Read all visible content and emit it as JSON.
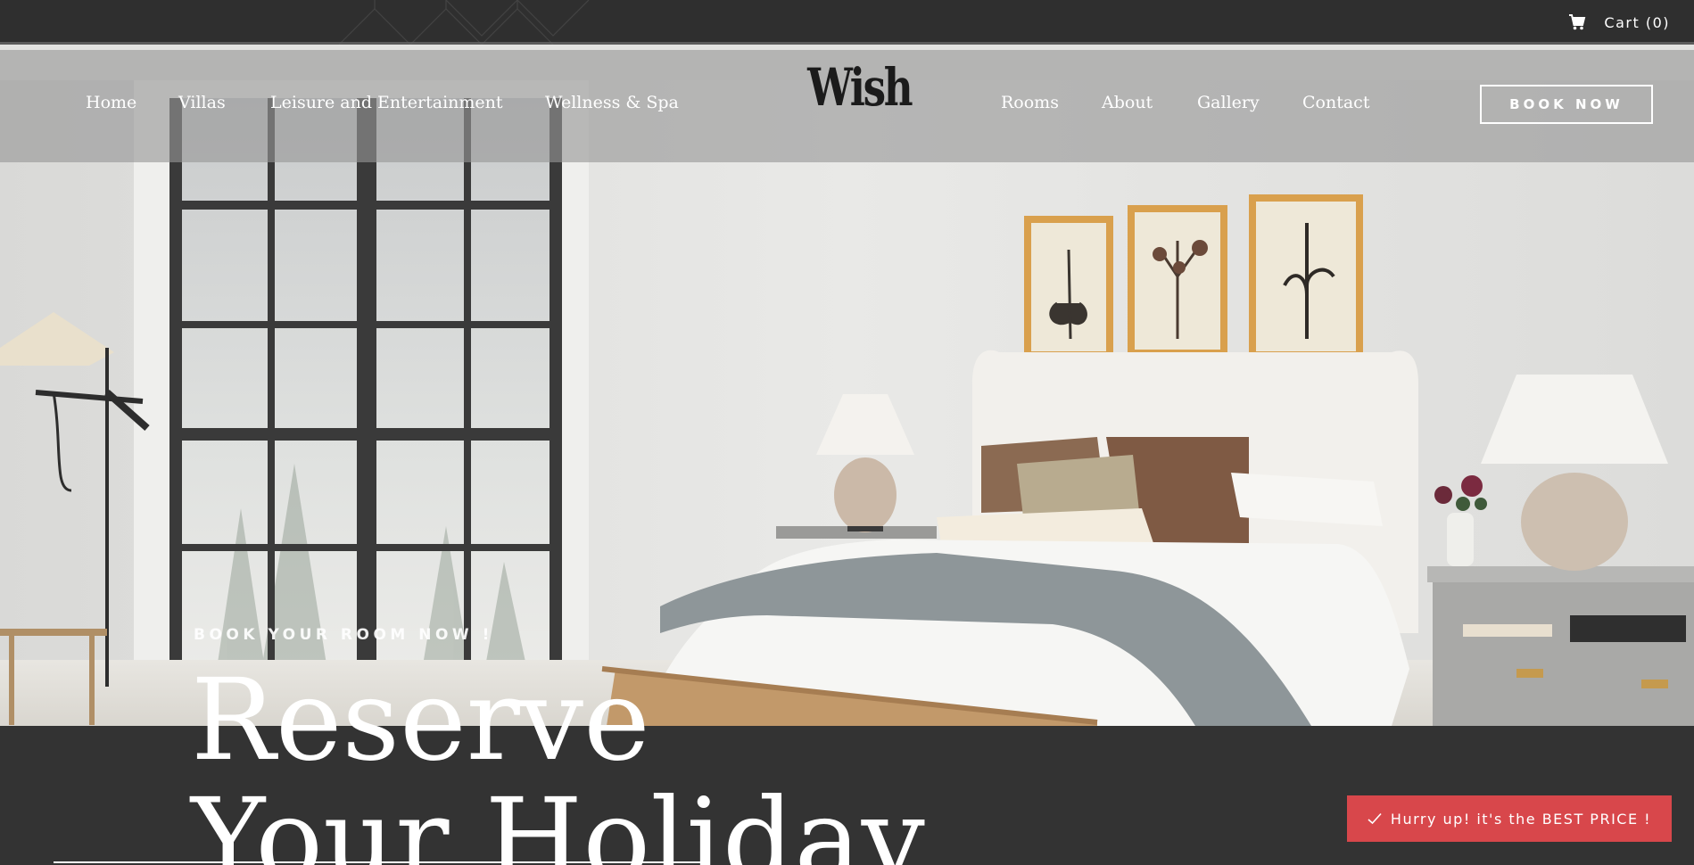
{
  "topbar": {
    "cart_label": "Cart (0)",
    "cart_icon": "cart-icon"
  },
  "nav": {
    "left": [
      {
        "label": "Home"
      },
      {
        "label": "Villas"
      },
      {
        "label": "Leisure and Entertainment"
      },
      {
        "label": "Wellness & Spa"
      }
    ],
    "right": [
      {
        "label": "Rooms"
      },
      {
        "label": "About"
      },
      {
        "label": "Gallery"
      },
      {
        "label": "Contact"
      }
    ],
    "logo_text": "Wish",
    "book_button": "BOOK NOW"
  },
  "hero": {
    "eyebrow": "BOOK YOUR ROOM NOW !",
    "headline_line1": "Reserve",
    "headline_line2": "Your Holiday"
  },
  "promo": {
    "label": "Hurry up! it's the BEST PRICE !",
    "icon": "check-icon"
  },
  "colors": {
    "dark_bg": "#333333",
    "nav_overlay": "#969696",
    "promo_red": "#d8474b",
    "text_white": "#ffffff"
  }
}
